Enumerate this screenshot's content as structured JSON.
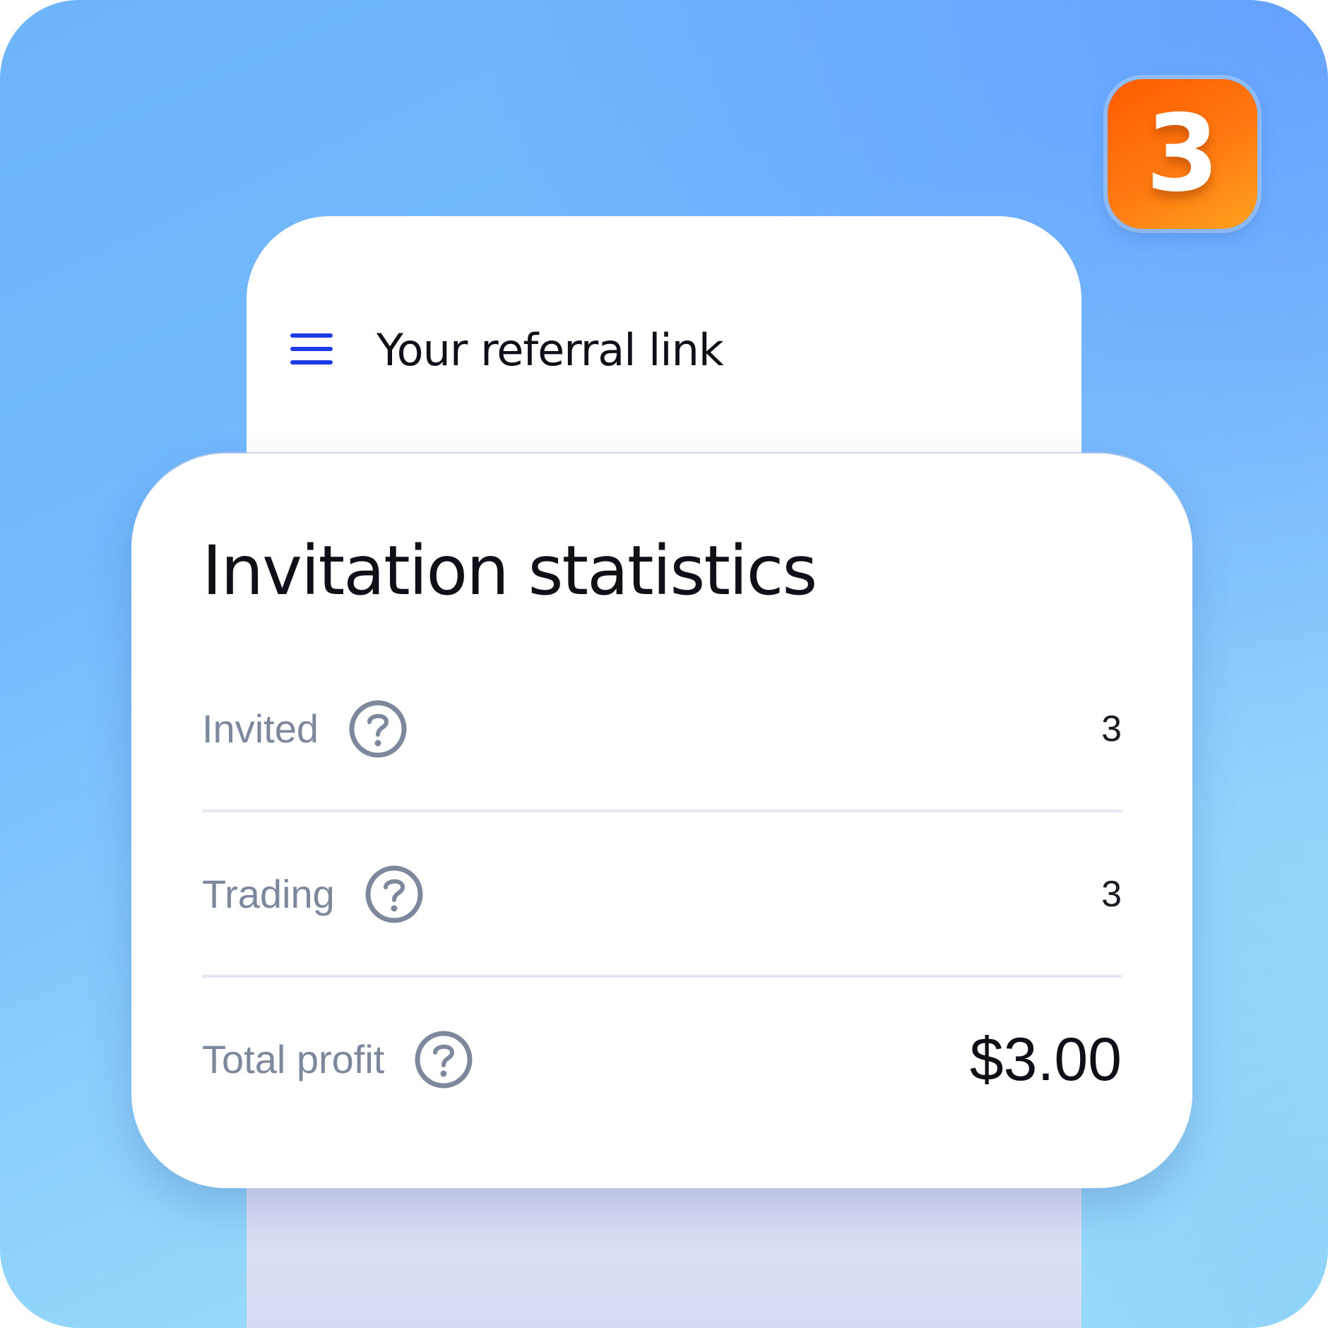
{
  "badge": {
    "number": "3",
    "color": "#ff6a00"
  },
  "header": {
    "title": "Your referral link",
    "menu_icon": "hamburger-menu-icon",
    "accent": "#1c3ae6"
  },
  "card": {
    "title": "Invitation statistics",
    "rows": [
      {
        "label": "Invited",
        "value": "3",
        "icon": "help-icon"
      },
      {
        "label": "Trading",
        "value": "3",
        "icon": "help-icon"
      },
      {
        "label": "Total profit",
        "value": "$3.00",
        "icon": "help-icon"
      }
    ]
  }
}
